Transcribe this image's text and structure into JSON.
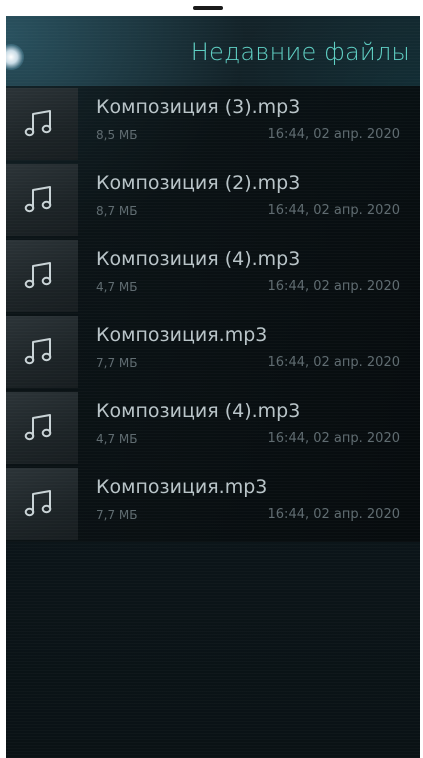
{
  "page": {
    "title": "Недавние файлы"
  },
  "colors": {
    "accent": "#5fd0c4",
    "primary_text": "#b9c4c8",
    "secondary_text": "#5f6b70",
    "background": "#0e1a1f"
  },
  "files": [
    {
      "name": "Композиция (3).mp3",
      "size": "8,5 МБ",
      "date": "16:44, 02 апр. 2020",
      "icon": "music-note-icon"
    },
    {
      "name": "Композиция (2).mp3",
      "size": "8,7 МБ",
      "date": "16:44, 02 апр. 2020",
      "icon": "music-note-icon"
    },
    {
      "name": "Композиция (4).mp3",
      "size": "4,7 МБ",
      "date": "16:44, 02 апр. 2020",
      "icon": "music-note-icon"
    },
    {
      "name": "Композиция.mp3",
      "size": "7,7 МБ",
      "date": "16:44, 02 апр. 2020",
      "icon": "music-note-icon"
    },
    {
      "name": "Композиция (4).mp3",
      "size": "4,7 МБ",
      "date": "16:44, 02 апр. 2020",
      "icon": "music-note-icon"
    },
    {
      "name": "Композиция.mp3",
      "size": "7,7 МБ",
      "date": "16:44, 02 апр. 2020",
      "icon": "music-note-icon"
    }
  ]
}
